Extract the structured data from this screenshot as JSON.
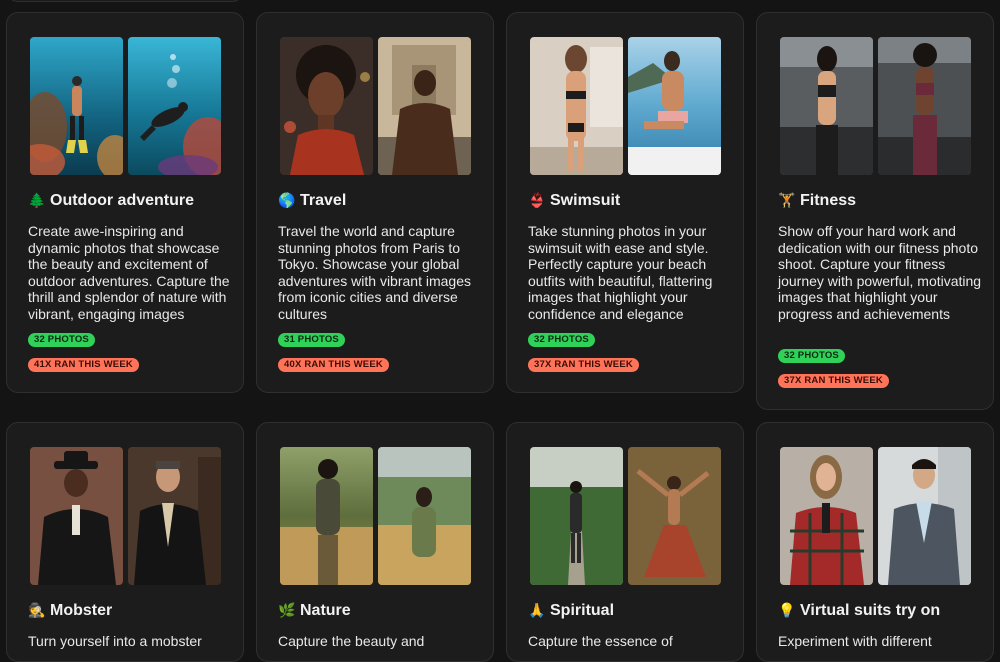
{
  "cards": [
    {
      "emoji": "🌲",
      "title": "Outdoor adventure",
      "description": "Create awe-inspiring and dynamic photos that showcase the beauty and excitement of outdoor adventures. Capture the thrill and splendor of nature with vibrant, engaging images",
      "photos_badge": "32 PHOTOS",
      "ran_badge": "41X RAN THIS WEEK",
      "images": [
        "scuba-diver-photo",
        "scuba-diver-photo"
      ]
    },
    {
      "emoji": "🌎",
      "title": "Travel",
      "description": "Travel the world and capture stunning photos from Paris to Tokyo. Showcase your global adventures with vibrant images from iconic cities and diverse cultures",
      "photos_badge": "31 PHOTOS",
      "ran_badge": "40X RAN THIS WEEK",
      "images": [
        "portrait-photo",
        "monument-photo"
      ]
    },
    {
      "emoji": "👙",
      "title": "Swimsuit",
      "description": "Take stunning photos in your swimsuit with ease and style. Perfectly capture your beach outfits with beautiful, flattering images that highlight your confidence and elegance",
      "photos_badge": "32 PHOTOS",
      "ran_badge": "37X RAN THIS WEEK",
      "images": [
        "swimsuit-photo",
        "beach-photo"
      ]
    },
    {
      "emoji": "🏋",
      "title": "Fitness",
      "description": "Show off your hard work and dedication with our fitness photo shoot. Capture your fitness journey with powerful, motivating images that highlight your progress and achievements",
      "photos_badge": "32 PHOTOS",
      "ran_badge": "37X RAN THIS WEEK",
      "images": [
        "gym-photo",
        "gym-photo"
      ]
    },
    {
      "emoji": "🕵",
      "title": "Mobster",
      "description": "Turn yourself into a mobster",
      "images": [
        "mobster-photo",
        "mobster-photo"
      ]
    },
    {
      "emoji": "🌿",
      "title": "Nature",
      "description": "Capture the beauty and",
      "images": [
        "field-photo",
        "field-photo"
      ]
    },
    {
      "emoji": "🙏",
      "title": "Spiritual",
      "description": "Capture the essence of",
      "images": [
        "garden-path-photo",
        "dancer-photo"
      ]
    },
    {
      "emoji": "💡",
      "title": "Virtual suits try on",
      "description": "Experiment with different",
      "images": [
        "plaid-suit-photo",
        "grey-suit-photo"
      ]
    }
  ],
  "colors": {
    "background": "#141414",
    "card": "#1c1c1c",
    "photos_badge": "#2fd158",
    "ran_badge": "#ff7459"
  }
}
